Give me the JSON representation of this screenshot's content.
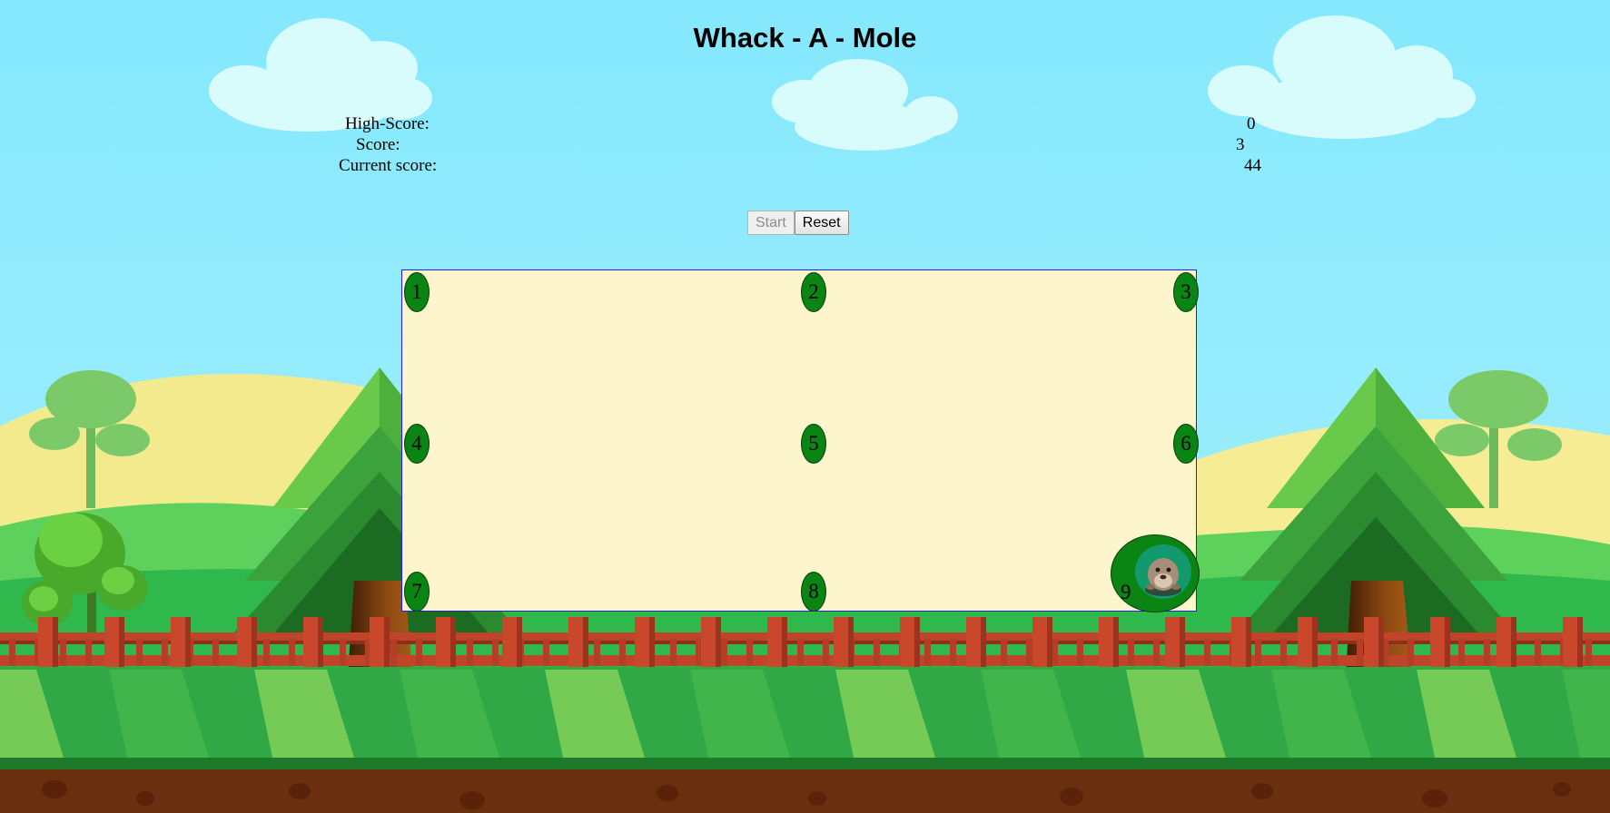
{
  "game": {
    "title": "Whack - A - Mole",
    "scores": {
      "high_score_label": "High-Score:",
      "high_score_value": "0",
      "score_label": "Score:",
      "score_value": "3",
      "current_score_label": "Current score:",
      "current_score_value": "44"
    },
    "buttons": {
      "start_label": "Start",
      "start_disabled": true,
      "reset_label": "Reset"
    },
    "holes": [
      "1",
      "2",
      "3",
      "4",
      "5",
      "6",
      "7",
      "8",
      "9"
    ],
    "active_hole": "9",
    "mole_icon": "mole-emoji"
  },
  "colors": {
    "sky": "#84e8fd",
    "board": "#fdf6cc",
    "board_border": "#1f1ff0",
    "hole": "#0a8412",
    "mole_ring": "#129a6e",
    "fence": "#c0442a",
    "grass": "#2fa845",
    "dirt": "#6a2f0f"
  }
}
